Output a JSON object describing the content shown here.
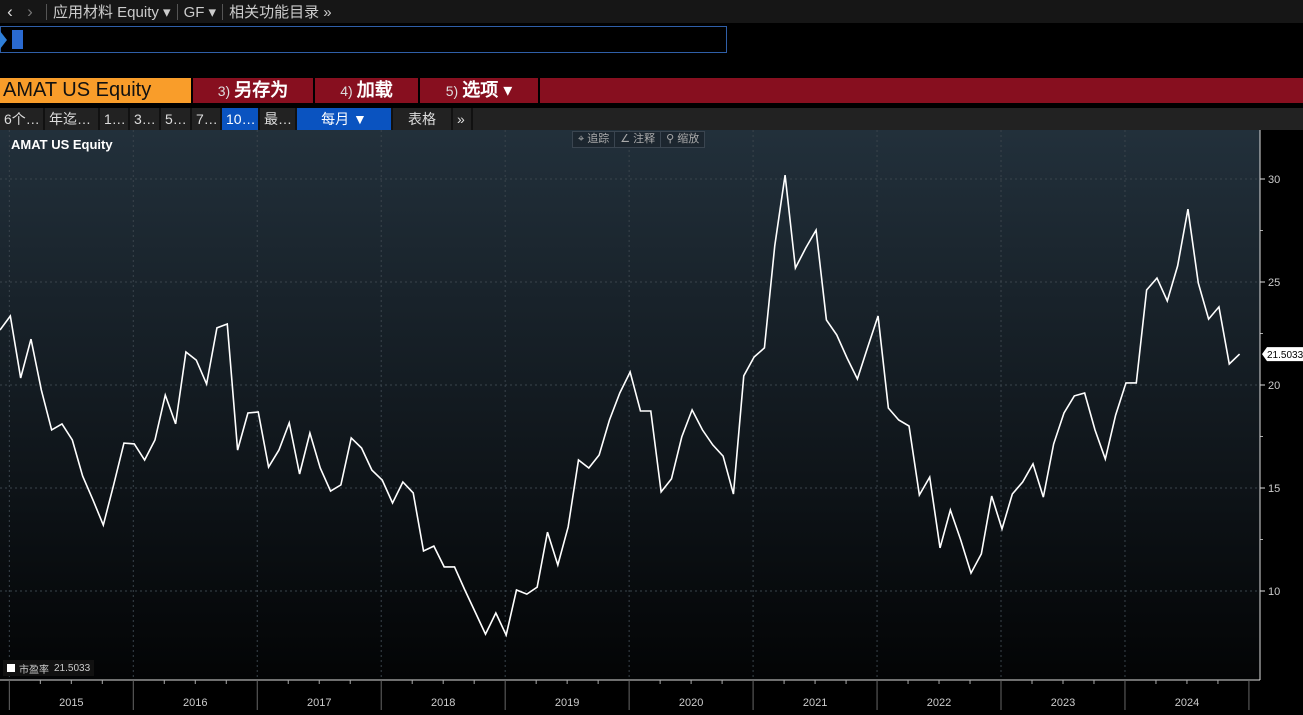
{
  "topbar": {
    "back": "‹",
    "forward": "›",
    "security": "应用材料 Equity ▾",
    "function": "GF ▾",
    "related": "相关功能目录 »"
  },
  "command": {
    "value": ""
  },
  "actionbar": {
    "ticker": "AMAT US Equity",
    "buttons": [
      {
        "num": "3)",
        "label": "另存为"
      },
      {
        "num": "4)",
        "label": "加载"
      },
      {
        "num": "5)",
        "label": "选项 ▾"
      }
    ]
  },
  "ranges": [
    "6个…",
    "年迄…",
    "1…",
    "3…",
    "5…",
    "7…",
    "10…",
    "最…"
  ],
  "selected_range": "10…",
  "frequency": "每月 ▼",
  "table_label": "表格",
  "more": "»",
  "chart_tools": [
    "⌖ 追踪",
    "∠ 注释",
    "⚲ 缩放"
  ],
  "chart_data": {
    "type": "line",
    "title": "AMAT US Equity",
    "xlabel": "",
    "ylabel": "",
    "x_tick_labels": [
      "2015",
      "2016",
      "2017",
      "2018",
      "2019",
      "2020",
      "2021",
      "2022",
      "2023",
      "2024"
    ],
    "y_ticks": [
      10,
      15,
      20,
      25,
      30
    ],
    "ylim": [
      6.5,
      32.5
    ],
    "grid": true,
    "legend_position": "bottom-left",
    "x_start": "2014-12",
    "frequency": "monthly",
    "series": [
      {
        "name": "市盈率",
        "last_value": "21.5033",
        "color": "#ffffff",
        "values": [
          22.67,
          23.35,
          20.34,
          22.23,
          19.76,
          17.82,
          18.11,
          17.33,
          15.58,
          14.42,
          13.2,
          15.15,
          17.18,
          17.14,
          16.36,
          17.33,
          19.51,
          18.11,
          21.6,
          21.21,
          20.05,
          22.77,
          22.96,
          16.84,
          18.64,
          18.69,
          16.02,
          16.84,
          18.16,
          15.68,
          17.67,
          15.97,
          14.85,
          15.15,
          17.43,
          16.94,
          15.87,
          15.39,
          14.27,
          15.29,
          14.76,
          11.94,
          12.18,
          11.17,
          11.17,
          10.05,
          8.98,
          7.91,
          8.93,
          7.86,
          10.05,
          9.85,
          10.19,
          12.86,
          11.26,
          13.11,
          16.36,
          15.97,
          16.6,
          18.3,
          19.61,
          20.63,
          18.74,
          18.74,
          14.81,
          15.44,
          17.48,
          18.79,
          17.82,
          17.09,
          16.55,
          14.71,
          20.44,
          21.36,
          21.8,
          26.75,
          30.19,
          25.68,
          26.65,
          27.52,
          23.16,
          22.43,
          21.31,
          20.29,
          21.84,
          23.35,
          18.88,
          18.3,
          18.01,
          14.66,
          15.53,
          12.09,
          13.93,
          12.48,
          10.87,
          11.8,
          14.61,
          13.01,
          14.71,
          15.29,
          16.17,
          14.56,
          17.14,
          18.64,
          19.47,
          19.61,
          17.82,
          16.41,
          18.54,
          20.1,
          20.1,
          24.61,
          25.19,
          24.08,
          25.78,
          28.54,
          24.95,
          23.2,
          23.79,
          21.02,
          21.5
        ]
      }
    ]
  }
}
